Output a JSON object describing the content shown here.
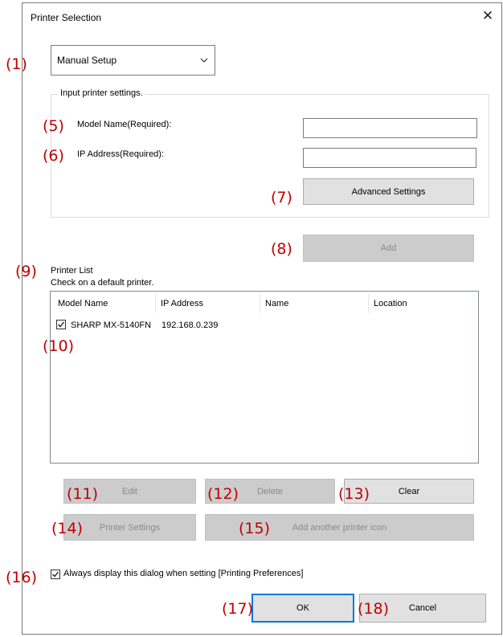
{
  "dialog": {
    "title": "Printer Selection",
    "close_glyph": "✕"
  },
  "annotations": [
    "(1)",
    "(5)",
    "(6)",
    "(7)",
    "(8)",
    "(9)",
    "(10)",
    "(11)",
    "(12)",
    "(13)",
    "(14)",
    "(15)",
    "(16)",
    "(17)",
    "(18)"
  ],
  "setup_combo": {
    "value": "Manual Setup",
    "icon": "chevron-down-icon"
  },
  "input_group": {
    "legend": "Input printer settings.",
    "model_name_label": "Model Name(Required):",
    "model_name_value": "",
    "ip_address_label": "IP Address(Required):",
    "ip_address_value": "",
    "advanced_settings": "Advanced Settings"
  },
  "add_button": "Add",
  "printer_list": {
    "title": "Printer List",
    "subtitle": "Check on a default printer.",
    "columns": [
      "Model Name",
      "IP Address",
      "Name",
      "Location"
    ],
    "rows": [
      {
        "checked": true,
        "model_name": "SHARP MX-5140FN",
        "ip_address": "192.168.0.239",
        "name": "",
        "location": ""
      }
    ]
  },
  "buttons": {
    "edit": "Edit",
    "delete": "Delete",
    "clear": "Clear",
    "printer_settings": "Printer Settings",
    "add_another_icon": "Add another printer icon",
    "ok": "OK",
    "cancel": "Cancel"
  },
  "always_display": {
    "checked": true,
    "label": "Always display this dialog when setting [Printing Preferences]"
  },
  "colors": {
    "annotation": "#c00000",
    "default_button_border": "#0078d7"
  }
}
